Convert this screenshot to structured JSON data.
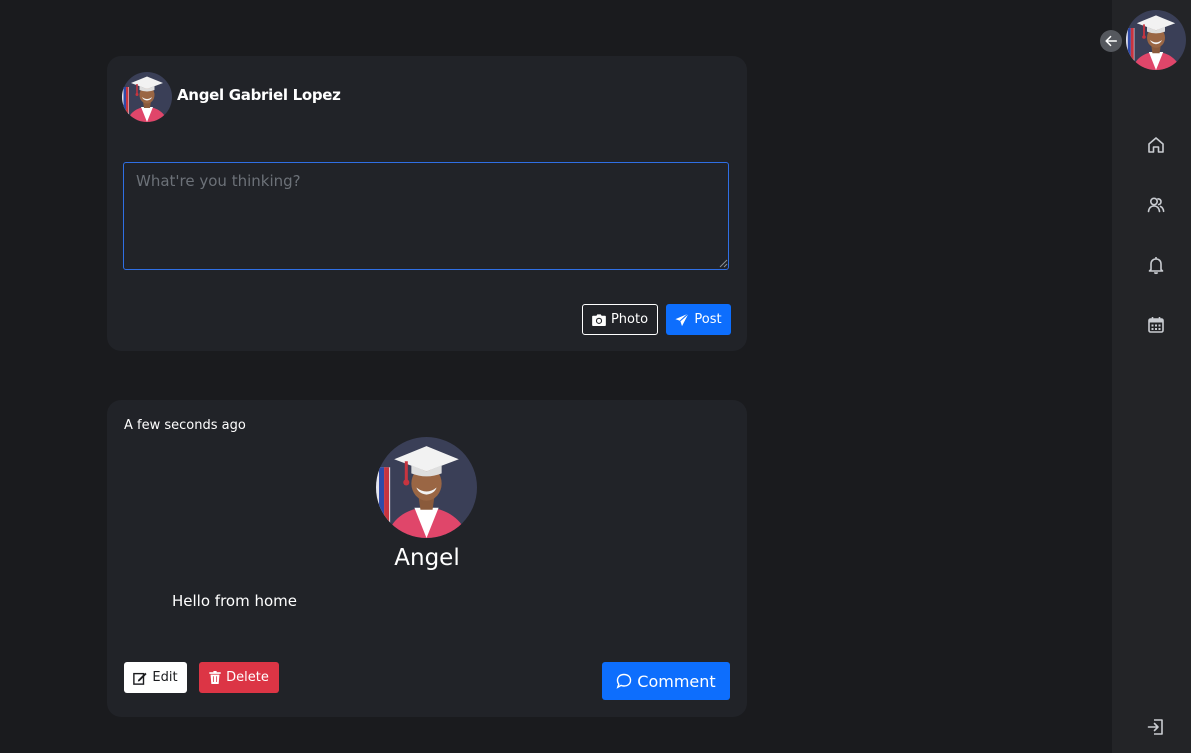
{
  "composer": {
    "user_name": "Angel Gabriel Lopez",
    "placeholder": "What're you thinking?",
    "photo_label": "Photo",
    "post_label": "Post"
  },
  "post": {
    "timestamp": "A few seconds ago",
    "author": "Angel",
    "body": "Hello from home",
    "edit_label": "Edit",
    "delete_label": "Delete",
    "comment_label": "Comment"
  },
  "sidebar": {
    "items": [
      {
        "icon": "home-icon"
      },
      {
        "icon": "friends-icon"
      },
      {
        "icon": "bell-icon"
      },
      {
        "icon": "calendar-icon"
      }
    ],
    "logout_icon": "logout-icon",
    "collapse_icon": "arrow-left-icon"
  },
  "colors": {
    "background": "#1a1b1e",
    "card": "#212328",
    "sidebar": "#232427",
    "primary": "#0d6efd",
    "danger": "#dc3545",
    "input_border": "#2f6fe4"
  }
}
